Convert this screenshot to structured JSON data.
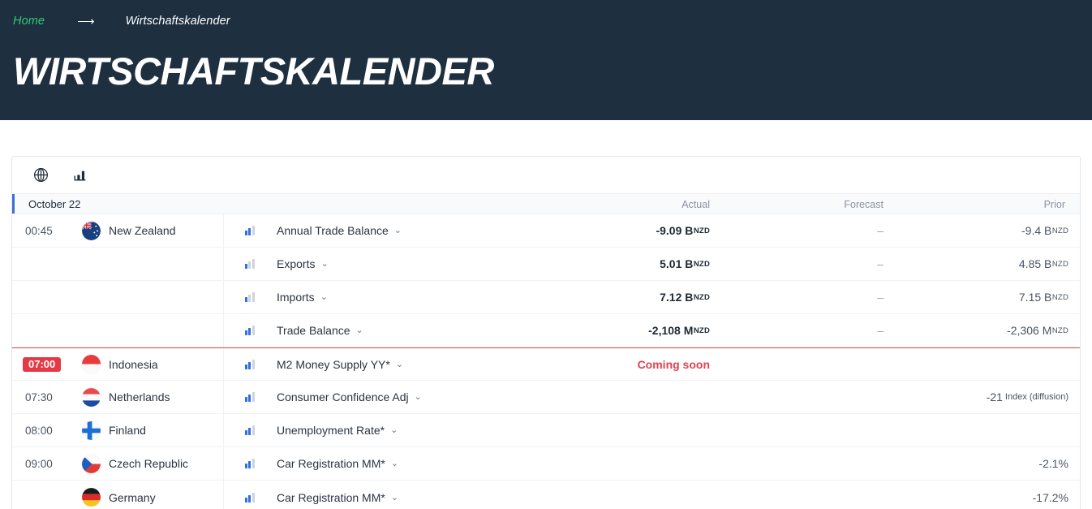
{
  "header": {
    "breadcrumb_home": "Home",
    "breadcrumb_separator": "⟶",
    "breadcrumb_current": "Wirtschaftskalender",
    "page_title": "WIRTSCHAFTSKALENDER"
  },
  "toolbar": {
    "globe_icon": "globe-icon",
    "chart_icon": "bar-chart-icon"
  },
  "table": {
    "date_label": "October 22",
    "columns": {
      "actual": "Actual",
      "forecast": "Forecast",
      "prior": "Prior"
    },
    "rows": [
      {
        "time": "00:45",
        "time_is_badge": false,
        "country": "New Zealand",
        "flag": "flag-new-zealand",
        "impact": 2,
        "event": "Annual Trade Balance",
        "actual": "-9.09 B",
        "actual_unit": "NZD",
        "forecast": "–",
        "prior": "-9.4 B",
        "prior_unit": "NZD"
      },
      {
        "time": "",
        "time_is_badge": false,
        "country": "",
        "flag": "",
        "impact": 1,
        "event": "Exports",
        "actual": "5.01 B",
        "actual_unit": "NZD",
        "forecast": "–",
        "prior": "4.85 B",
        "prior_unit": "NZD"
      },
      {
        "time": "",
        "time_is_badge": false,
        "country": "",
        "flag": "",
        "impact": 1,
        "event": "Imports",
        "actual": "7.12 B",
        "actual_unit": "NZD",
        "forecast": "–",
        "prior": "7.15 B",
        "prior_unit": "NZD"
      },
      {
        "time": "",
        "time_is_badge": false,
        "country": "",
        "flag": "",
        "impact": 2,
        "event": "Trade Balance",
        "actual": "-2,108 M",
        "actual_unit": "NZD",
        "forecast": "–",
        "prior": "-2,306 M",
        "prior_unit": "NZD"
      },
      {
        "time": "07:00",
        "time_is_badge": true,
        "country": "Indonesia",
        "flag": "flag-indonesia",
        "impact": 2,
        "event": "M2 Money Supply YY*",
        "actual": "Coming soon",
        "actual_is_coming_soon": true,
        "forecast": "",
        "prior": "",
        "prior_unit": ""
      },
      {
        "time": "07:30",
        "time_is_badge": false,
        "country": "Netherlands",
        "flag": "flag-netherlands",
        "impact": 2,
        "event": "Consumer Confidence Adj",
        "actual": "",
        "forecast": "",
        "prior": "-21",
        "prior_unit_wide": "Index (diffusion)"
      },
      {
        "time": "08:00",
        "time_is_badge": false,
        "country": "Finland",
        "flag": "flag-finland",
        "impact": 2,
        "event": "Unemployment Rate*",
        "actual": "",
        "forecast": "",
        "prior": ""
      },
      {
        "time": "09:00",
        "time_is_badge": false,
        "country": "Czech Republic",
        "flag": "flag-czech-republic",
        "impact": 2,
        "event": "Car Registration MM*",
        "actual": "",
        "forecast": "",
        "prior": "-2.1%"
      },
      {
        "time": "",
        "time_is_badge": false,
        "country": "Germany",
        "flag": "flag-germany",
        "impact": 2,
        "event": "Car Registration MM*",
        "actual": "",
        "forecast": "",
        "prior": "-17.2%"
      }
    ]
  },
  "colors": {
    "header_bg": "#1e3040",
    "accent_green": "#2ecc71",
    "accent_blue": "#3b6fd4",
    "impact_blue": "#2f6fe0",
    "badge_red": "#e63946",
    "coming_soon_red": "#e0414f",
    "divider_red": "#d94a4a"
  }
}
